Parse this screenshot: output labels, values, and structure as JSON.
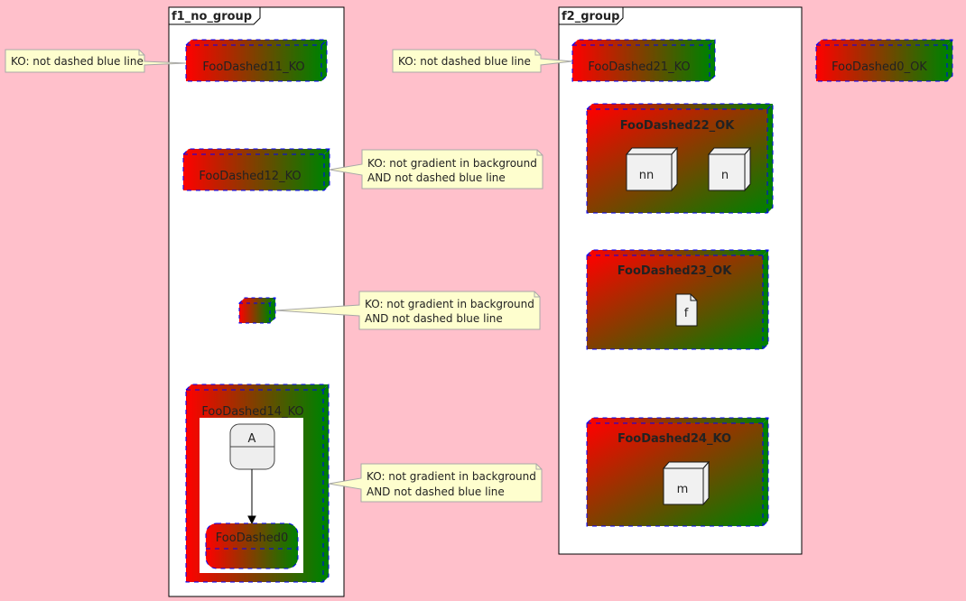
{
  "colors": {
    "background": "#FFC0CB",
    "gradient_start": "#FF0000",
    "gradient_end": "#008000",
    "dashed_border": "#0000FF",
    "note_fill": "#FEFECE",
    "frame_fill": "#FFFFFF"
  },
  "frames": {
    "f1": {
      "title": "f1_no_group"
    },
    "f2": {
      "title": "f2_group"
    }
  },
  "nodes": {
    "foo11": "FooDashed11_KO",
    "foo12": "FooDashed12_KO",
    "foo14": "FooDashed14_KO",
    "foo14_state_a": "A",
    "foo14_state_foo0": "FooDashed0",
    "foo21": "FooDashed21_KO",
    "foo22": "FooDashed22_OK",
    "foo22_nn": "nn",
    "foo22_n": "n",
    "foo23": "FooDashed23_OK",
    "foo23_f": "f",
    "foo24": "FooDashed24_KO",
    "foo24_m": "m",
    "foo0": "FooDashed0_OK"
  },
  "notes": {
    "note11": [
      "KO: not dashed blue line"
    ],
    "note12": [
      "KO: not gradient in background",
      "AND not dashed blue line"
    ],
    "note13": [
      "KO: not gradient in background",
      "AND not dashed blue line"
    ],
    "note14": [
      "KO: not gradient in background",
      "AND not dashed blue line"
    ],
    "note21": [
      "KO: not dashed blue line"
    ]
  }
}
